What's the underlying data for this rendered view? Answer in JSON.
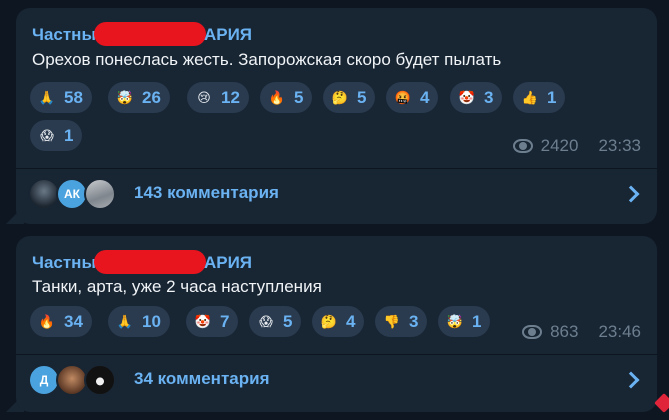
{
  "posts": [
    {
      "author_start": "Частны",
      "author_end": "АРИЯ",
      "text": "Орехов понеслась жесть. Запорожская скоро будет пылать",
      "reactions": [
        {
          "icon": "folded-hands-icon",
          "glyph": "🙏",
          "count": "58"
        },
        {
          "icon": "exploding-head-icon",
          "glyph": "🤯",
          "count": "26"
        },
        {
          "icon": "crying-face-icon",
          "glyph": "😢",
          "count": "12"
        },
        {
          "icon": "fire-icon",
          "glyph": "🔥",
          "count": "5"
        },
        {
          "icon": "thinking-face-icon",
          "glyph": "🤔",
          "count": "5"
        },
        {
          "icon": "cursing-face-icon",
          "glyph": "🤬",
          "count": "4"
        },
        {
          "icon": "clown-face-icon",
          "glyph": "🤡",
          "count": "3"
        },
        {
          "icon": "thumbs-up-icon",
          "glyph": "👍",
          "count": "1"
        },
        {
          "icon": "screaming-face-icon",
          "glyph": "😱",
          "count": "1"
        }
      ],
      "views": "2420",
      "time": "23:33",
      "comments": {
        "label": "143 комментария",
        "avatars": [
          "photo",
          "АК",
          "photo"
        ]
      }
    },
    {
      "author_start": "Частны",
      "author_end": "АРИЯ",
      "text": "Танки, арта, уже 2 часа наступления",
      "reactions": [
        {
          "icon": "fire-icon",
          "glyph": "🔥",
          "count": "34"
        },
        {
          "icon": "folded-hands-icon",
          "glyph": "🙏",
          "count": "10"
        },
        {
          "icon": "clown-face-icon",
          "glyph": "🤡",
          "count": "7"
        },
        {
          "icon": "screaming-face-icon",
          "glyph": "😱",
          "count": "5"
        },
        {
          "icon": "thinking-face-icon",
          "glyph": "🤔",
          "count": "4"
        },
        {
          "icon": "thumbs-down-icon",
          "glyph": "👎",
          "count": "3"
        },
        {
          "icon": "exploding-head-icon",
          "glyph": "🤯",
          "count": "1"
        }
      ],
      "views": "863",
      "time": "23:46",
      "comments": {
        "label": "34 комментария",
        "avatars": [
          "Д",
          "photo",
          "photo"
        ]
      }
    }
  ],
  "colors": {
    "background": "#0e1621",
    "bubble": "#182533",
    "accent": "#6ab2f2",
    "chip": "#2a3b4f",
    "meta": "#6d7f8f",
    "redaction": "#e8141e"
  }
}
